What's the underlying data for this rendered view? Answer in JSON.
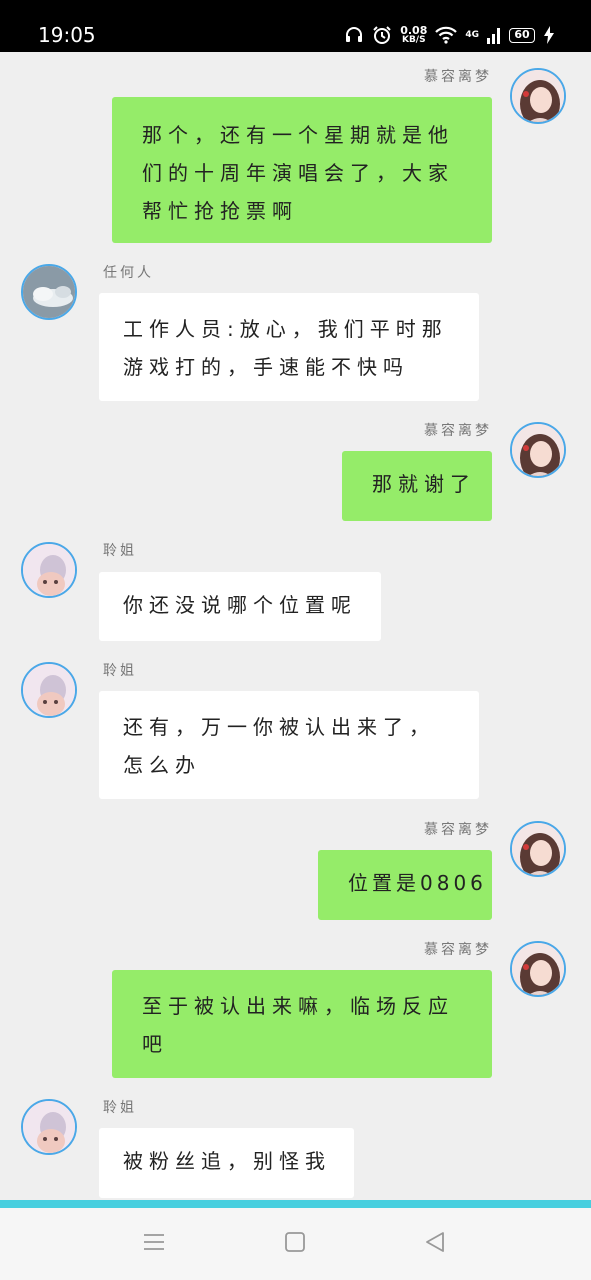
{
  "status_bar": {
    "time": "19:05",
    "net_speed_value": "0.08",
    "net_speed_unit": "KB/S",
    "network_type": "4G",
    "battery_level": "60",
    "icons": [
      "headphones-icon",
      "alarm-icon",
      "wifi-icon",
      "signal-icon",
      "battery-icon",
      "charging-icon"
    ]
  },
  "messages": [
    {
      "side": "right",
      "sender": "慕容离梦",
      "lines": [
        "那个，还有一个星期就是他",
        "们的十周年演唱会了，大家",
        "帮忙抢抢票啊"
      ]
    },
    {
      "side": "left",
      "sender": "任何人",
      "lines": [
        "工作人员:放心，我们平时那",
        "游戏打的，手速能不快吗"
      ]
    },
    {
      "side": "right",
      "sender": "慕容离梦",
      "lines": [
        "那就谢了"
      ]
    },
    {
      "side": "left",
      "sender": "聆姐",
      "lines": [
        "你还没说哪个位置呢"
      ]
    },
    {
      "side": "left",
      "sender": "聆姐",
      "lines": [
        "还有，万一你被认出来了，",
        "怎么办"
      ]
    },
    {
      "side": "right",
      "sender": "慕容离梦",
      "lines": [
        "位置是0806"
      ]
    },
    {
      "side": "right",
      "sender": "慕容离梦",
      "lines": [
        "至于被认出来嘛，临场反应",
        "吧"
      ]
    },
    {
      "side": "left",
      "sender": "聆姐",
      "lines": [
        "被粉丝追，别怪我"
      ]
    }
  ],
  "nav_bar": {
    "buttons": [
      "menu-icon",
      "home-icon",
      "back-icon"
    ]
  },
  "colors": {
    "green_bubble": "#95ec69",
    "white_bubble": "#ffffff",
    "background": "#efefef",
    "avatar_border": "#4aa8e8",
    "accent_line": "#47cfdf"
  }
}
